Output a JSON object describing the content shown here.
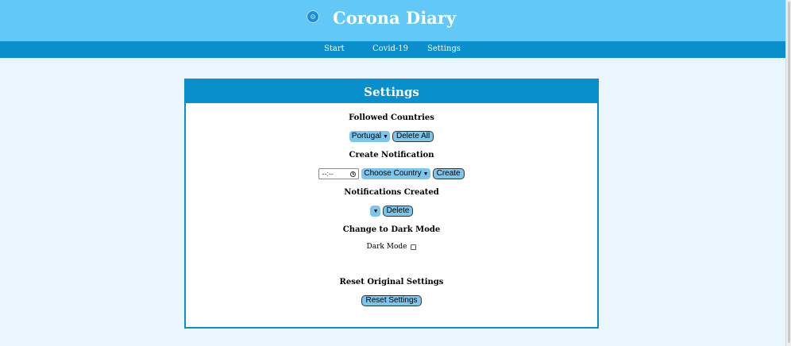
{
  "header": {
    "title": "Corona Diary",
    "logo_icon": "coronavirus-logo-icon"
  },
  "nav": {
    "items": [
      "Start",
      "Covid-19",
      "Settings"
    ]
  },
  "settings": {
    "title": "Settings",
    "followed": {
      "heading": "Followed Countries",
      "selected_country": "Portugal",
      "delete_all_label": "Delete All"
    },
    "create_notification": {
      "heading": "Create Notification",
      "time_value": "--:--",
      "country_select": "Choose Country",
      "create_label": "Create"
    },
    "notifications_created": {
      "heading": "Notifications Created",
      "selected": "",
      "delete_label": "Delete"
    },
    "dark_mode": {
      "heading": "Change to Dark Mode",
      "label": "Dark Mode",
      "checked": false
    },
    "reset": {
      "heading": "Reset Original Settings",
      "button_label": "Reset Settings"
    }
  },
  "colors": {
    "header_bg": "#61c8f7",
    "nav_bg": "#0a8fcd",
    "page_bg": "#eaf5fd",
    "button_bg": "#7cc6ee"
  }
}
